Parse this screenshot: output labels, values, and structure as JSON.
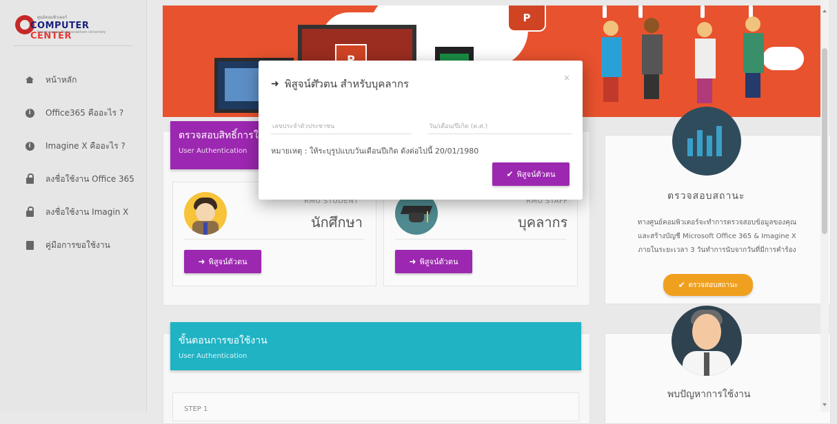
{
  "brand": {
    "name_part1": "COMPUTER",
    "name_part2": "CENTER",
    "small_top": "ศูนย์คอมพิวเตอร์",
    "small_bottom": "Rajamangala Mahasarakham University"
  },
  "sidebar": {
    "items": [
      {
        "label": "หน้าหลัก",
        "icon": "home-icon"
      },
      {
        "label": "Office365 คืออะไร ?",
        "icon": "info-icon"
      },
      {
        "label": "Imagine X คืออะไร ?",
        "icon": "info-icon"
      },
      {
        "label": "ลงชื่อใช้งาน Office 365",
        "icon": "lock-icon"
      },
      {
        "label": "ลงชื่อใช้งาน Imagin X",
        "icon": "lock-icon"
      },
      {
        "label": "คู่มือการขอใช้งาน",
        "icon": "book-icon"
      }
    ]
  },
  "banner": {
    "ppt_text": "P",
    "ppt_top_text": "P"
  },
  "rights_card": {
    "title": "ตรวจสอบสิทธิ์การใช้งาน",
    "subtitle": "User Authentication",
    "student": {
      "tag": "RMU STUDENT",
      "name": "นักศึกษา",
      "button": "พิสูจน์ตัวตน"
    },
    "staff": {
      "tag": "RMU STAFF",
      "name": "บุคลากร",
      "button": "พิสูจน์ตัวตน"
    }
  },
  "status_card": {
    "title": "ตรวจสอบสถานะ",
    "lines": [
      "ทางศูนย์คอมพิวเตอร์จะทำการตรวจสอบข้อมูลของคุณ",
      "และสร้างบัญชี Microsoft Office 365 & Imagine X",
      "ภายในระยะเวลา 3 วันทำการนับจากวันที่มีการคำร้อง"
    ],
    "button": "ตรวจสอบสถานะ"
  },
  "steps_card": {
    "title": "ขั้นตอนการขอใช้งาน",
    "subtitle": "User Authentication",
    "step_label": "STEP 1"
  },
  "help_card": {
    "title": "พบปัญหาการใช้งาน"
  },
  "modal": {
    "title": "พิสูจน์ตัวตน สำหรับบุคลากร",
    "close": "×",
    "id_placeholder": "เลขประจำตัวประชาชน",
    "dob_placeholder": "วัน/เดือน/ปีเกิด (ค.ศ.)",
    "note": "หมายเหตุ : ให้ระบุรูปแบบวันเดือนปีเกิด ดังต่อไปนี้ 20/01/1980",
    "button": "พิสูจน์ตัวตน"
  },
  "colors": {
    "purple": "#9c27b0",
    "teal": "#1fb3c4",
    "orange": "#f0a01f",
    "banner": "#e8522e"
  }
}
